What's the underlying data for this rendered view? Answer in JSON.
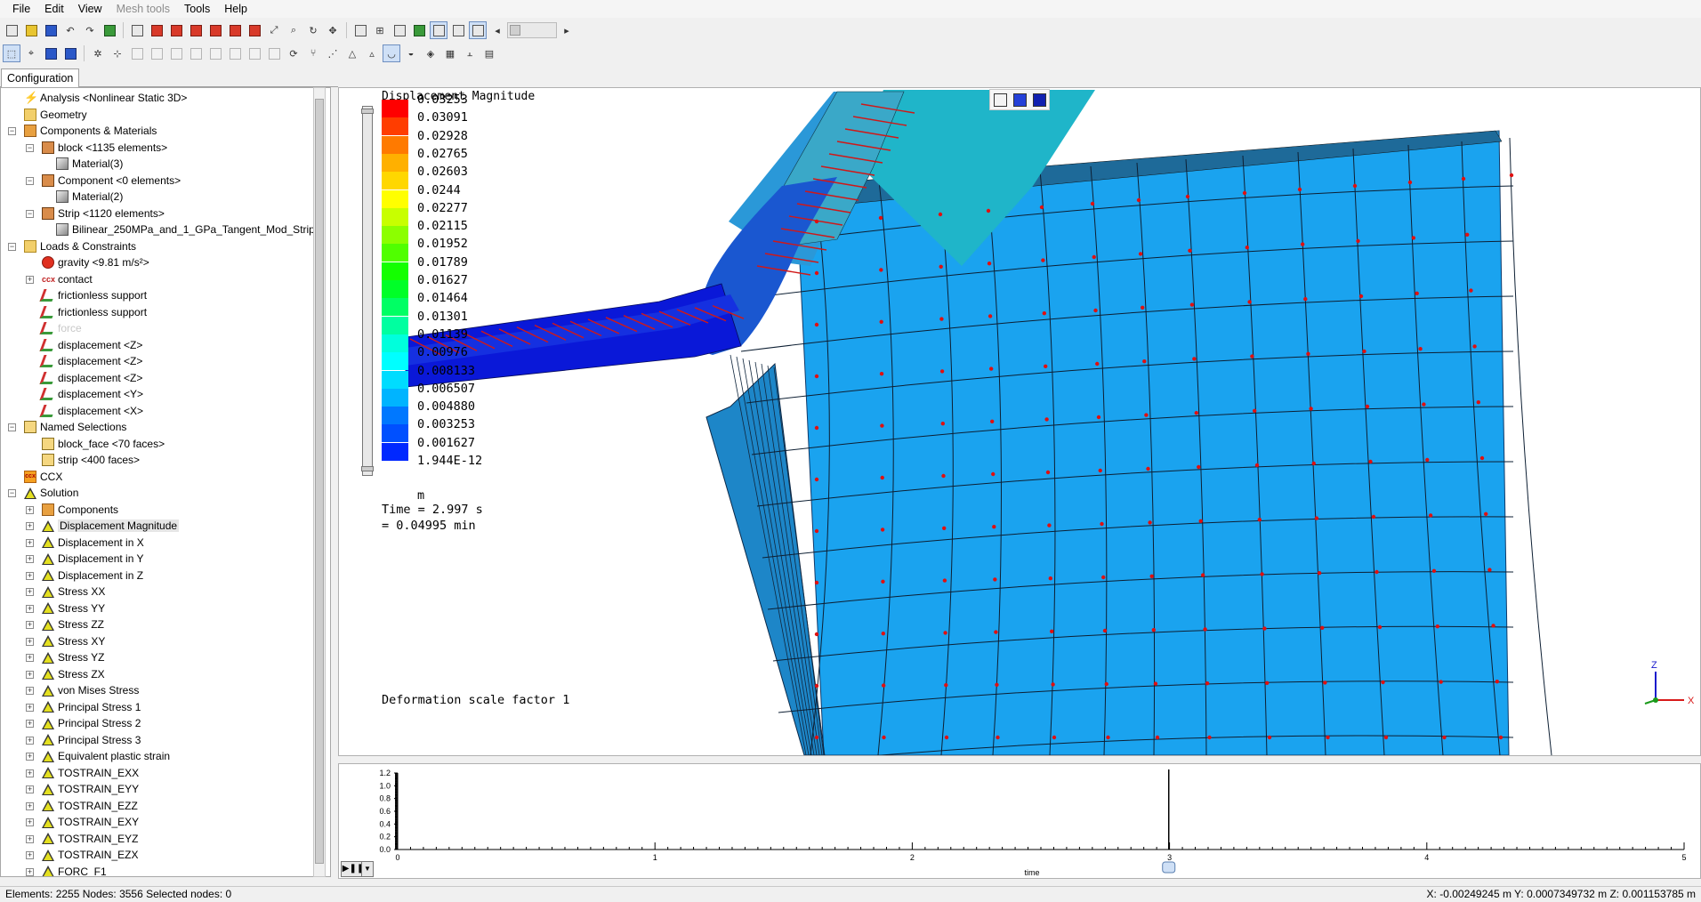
{
  "menu": [
    "File",
    "Edit",
    "View",
    "Mesh tools",
    "Tools",
    "Help"
  ],
  "menu_disabled": "Mesh tools",
  "panel_tab": "Configuration",
  "tree": [
    {
      "label": "Analysis <Nonlinear Static 3D>",
      "level": 1,
      "icon": "analysis-icon",
      "expander": "none"
    },
    {
      "label": "Geometry",
      "level": 1,
      "icon": "folder-icon",
      "expander": "none"
    },
    {
      "label": "Components & Materials",
      "level": 1,
      "icon": "components-icon",
      "expander": "minus"
    },
    {
      "label": "block <1135 elements>",
      "level": 2,
      "icon": "cube-icon",
      "expander": "minus"
    },
    {
      "label": "Material(3)",
      "level": 3,
      "icon": "material-icon",
      "expander": "none"
    },
    {
      "label": "Component <0 elements>",
      "level": 2,
      "icon": "cube-icon",
      "expander": "minus"
    },
    {
      "label": "Material(2)",
      "level": 3,
      "icon": "material-icon",
      "expander": "none"
    },
    {
      "label": "Strip <1120 elements>",
      "level": 2,
      "icon": "cube-icon",
      "expander": "minus"
    },
    {
      "label": "Bilinear_250MPa_and_1_GPa_Tangent_Mod_Strip",
      "level": 3,
      "icon": "material-icon",
      "expander": "none"
    },
    {
      "label": "Loads & Constraints",
      "level": 1,
      "icon": "loads-icon",
      "expander": "minus"
    },
    {
      "label": "gravity <9.81 m/s²>",
      "level": 2,
      "icon": "gravity-icon",
      "expander": "none"
    },
    {
      "label": "contact",
      "level": 2,
      "icon": "contact-icon",
      "expander": "plus"
    },
    {
      "label": "frictionless support",
      "level": 2,
      "icon": "support-icon",
      "expander": "none"
    },
    {
      "label": "frictionless support",
      "level": 2,
      "icon": "support-icon",
      "expander": "none"
    },
    {
      "label": "force",
      "level": 2,
      "icon": "support-icon",
      "expander": "none",
      "disabled": true
    },
    {
      "label": "displacement <Z>",
      "level": 2,
      "icon": "support-icon",
      "expander": "none"
    },
    {
      "label": "displacement <Z>",
      "level": 2,
      "icon": "support-icon",
      "expander": "none"
    },
    {
      "label": "displacement <Z>",
      "level": 2,
      "icon": "support-icon",
      "expander": "none"
    },
    {
      "label": "displacement <Y>",
      "level": 2,
      "icon": "support-icon",
      "expander": "none"
    },
    {
      "label": "displacement <X>",
      "level": 2,
      "icon": "support-icon",
      "expander": "none"
    },
    {
      "label": "Named Selections",
      "level": 1,
      "icon": "named-selection-icon",
      "expander": "minus"
    },
    {
      "label": "block_face <70 faces>",
      "level": 2,
      "icon": "named-selection-icon",
      "expander": "none"
    },
    {
      "label": "strip <400 faces>",
      "level": 2,
      "icon": "named-selection-icon",
      "expander": "none"
    },
    {
      "label": "CCX",
      "level": 1,
      "icon": "ccx-icon",
      "expander": "none"
    },
    {
      "label": "Solution",
      "level": 1,
      "icon": "result-icon",
      "expander": "minus"
    },
    {
      "label": "Components",
      "level": 2,
      "icon": "components-icon",
      "expander": "plus"
    },
    {
      "label": "Displacement Magnitude",
      "level": 2,
      "icon": "result-icon",
      "expander": "plus",
      "selected": true
    },
    {
      "label": "Displacement in X",
      "level": 2,
      "icon": "result-icon",
      "expander": "plus"
    },
    {
      "label": "Displacement in Y",
      "level": 2,
      "icon": "result-icon",
      "expander": "plus"
    },
    {
      "label": "Displacement in Z",
      "level": 2,
      "icon": "result-icon",
      "expander": "plus"
    },
    {
      "label": "Stress XX",
      "level": 2,
      "icon": "result-icon",
      "expander": "plus"
    },
    {
      "label": "Stress YY",
      "level": 2,
      "icon": "result-icon",
      "expander": "plus"
    },
    {
      "label": "Stress ZZ",
      "level": 2,
      "icon": "result-icon",
      "expander": "plus"
    },
    {
      "label": "Stress XY",
      "level": 2,
      "icon": "result-icon",
      "expander": "plus"
    },
    {
      "label": "Stress YZ",
      "level": 2,
      "icon": "result-icon",
      "expander": "plus"
    },
    {
      "label": "Stress ZX",
      "level": 2,
      "icon": "result-icon",
      "expander": "plus"
    },
    {
      "label": "von Mises Stress",
      "level": 2,
      "icon": "result-icon",
      "expander": "plus"
    },
    {
      "label": "Principal Stress 1",
      "level": 2,
      "icon": "result-icon",
      "expander": "plus"
    },
    {
      "label": "Principal Stress 2",
      "level": 2,
      "icon": "result-icon",
      "expander": "plus"
    },
    {
      "label": "Principal Stress 3",
      "level": 2,
      "icon": "result-icon",
      "expander": "plus"
    },
    {
      "label": "Equivalent plastic strain",
      "level": 2,
      "icon": "result-icon",
      "expander": "plus"
    },
    {
      "label": "TOSTRAIN_EXX",
      "level": 2,
      "icon": "result-icon",
      "expander": "plus"
    },
    {
      "label": "TOSTRAIN_EYY",
      "level": 2,
      "icon": "result-icon",
      "expander": "plus"
    },
    {
      "label": "TOSTRAIN_EZZ",
      "level": 2,
      "icon": "result-icon",
      "expander": "plus"
    },
    {
      "label": "TOSTRAIN_EXY",
      "level": 2,
      "icon": "result-icon",
      "expander": "plus"
    },
    {
      "label": "TOSTRAIN_EYZ",
      "level": 2,
      "icon": "result-icon",
      "expander": "plus"
    },
    {
      "label": "TOSTRAIN_EZX",
      "level": 2,
      "icon": "result-icon",
      "expander": "plus"
    },
    {
      "label": "FORC_F1",
      "level": 2,
      "icon": "result-icon",
      "expander": "plus"
    },
    {
      "label": "FORC_F2",
      "level": 2,
      "icon": "result-icon",
      "expander": "plus"
    },
    {
      "label": "FORC_F3",
      "level": 2,
      "icon": "result-icon",
      "expander": "plus"
    }
  ],
  "legend": {
    "title": "Displacement Magnitude",
    "values": [
      "0.03253",
      "0.03091",
      "0.02928",
      "0.02765",
      "0.02603",
      "0.0244",
      "0.02277",
      "0.02115",
      "0.01952",
      "0.01789",
      "0.01627",
      "0.01464",
      "0.01301",
      "0.01139",
      "0.00976",
      "0.008133",
      "0.006507",
      "0.004880",
      "0.003253",
      "0.001627",
      "1.944E-12"
    ],
    "colors": [
      "#ff0000",
      "#ff3d00",
      "#ff7a00",
      "#ffb000",
      "#ffd700",
      "#ffff00",
      "#c8ff00",
      "#8cff00",
      "#50ff00",
      "#14ff00",
      "#00ff28",
      "#00ff64",
      "#00ffa0",
      "#00ffdc",
      "#00ffff",
      "#00dcff",
      "#00b4ff",
      "#0078ff",
      "#0050ff",
      "#0028ff",
      "#0000ff"
    ],
    "unit": "m"
  },
  "time_line1": "Time = 2.997 s",
  "time_line2": "= 0.04995 min",
  "deformation": "Deformation scale factor 1",
  "axes_labels": {
    "z": "Z",
    "x": "X"
  },
  "colors": {
    "block": "#1aa3ef",
    "strip_dark": "#0a18d8",
    "strip_light": "#28b6c8",
    "node": "#e01010"
  },
  "timeline": {
    "y_ticks": [
      "1.2",
      "1.0",
      "0.8",
      "0.6",
      "0.4",
      "0.2",
      "0.0"
    ],
    "x_ticks": [
      "0",
      "1",
      "2",
      "3",
      "4",
      "5"
    ],
    "xlabel": "time",
    "current_time": 2.997
  },
  "status": {
    "left": "Elements: 2255   Nodes: 3556   Selected nodes: 0",
    "right": "X: -0.00249245 m Y: 0.0007349732 m Z: 0.001153785 m"
  }
}
